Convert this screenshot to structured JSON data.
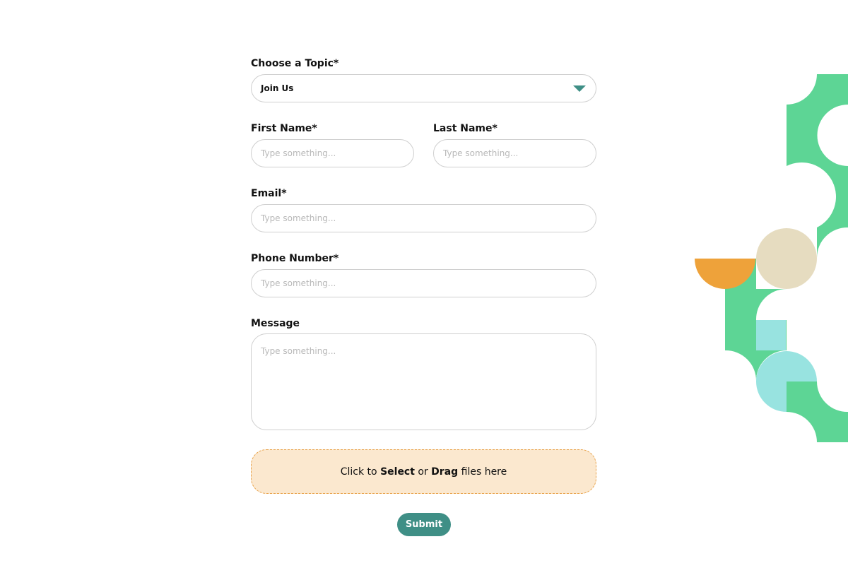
{
  "form": {
    "topic": {
      "label": "Choose a Topic*",
      "value": "Join Us"
    },
    "first_name": {
      "label": "First Name*",
      "placeholder": "Type something..."
    },
    "last_name": {
      "label": "Last Name*",
      "placeholder": "Type something..."
    },
    "email": {
      "label": "Email*",
      "placeholder": "Type something..."
    },
    "phone": {
      "label": "Phone Number*",
      "placeholder": "Type something..."
    },
    "message": {
      "label": "Message",
      "placeholder": "Type something..."
    },
    "upload": {
      "prefix": "Click to ",
      "select": "Select",
      "middle": " or ",
      "drag": "Drag",
      "suffix": " files here"
    },
    "submit_label": "Submit"
  },
  "colors": {
    "accent": "#3f8f86",
    "dropzone_fill": "#fbe8cf",
    "dropzone_border": "#e8a24a",
    "deco_green": "#5dd595",
    "deco_orange": "#eea23a",
    "deco_beige": "#e6dcc0",
    "deco_cyan": "#98e3e0"
  },
  "icons": {
    "dropdown": "caret-down-icon"
  }
}
